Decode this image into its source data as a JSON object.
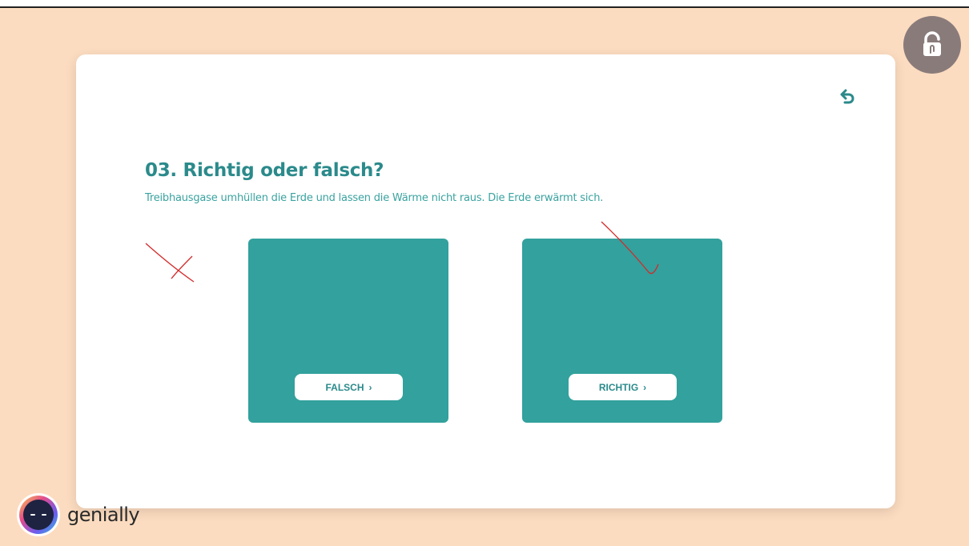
{
  "card": {
    "title": "03. Richtig oder falsch?",
    "statement": "Treibhausgase umhüllen die Erde und lassen die Wärme nicht raus. Die Erde erwärmt sich."
  },
  "options": [
    {
      "label": "FALSCH",
      "chevron": "›"
    },
    {
      "label": "RICHTIG",
      "chevron": "›"
    }
  ],
  "icons": {
    "back": "undo-arrow-icon",
    "lock": "hand-unlock-icon",
    "brand": "genially-logo-icon"
  },
  "brand": {
    "name": "genially"
  },
  "colors": {
    "background": "#fcdcc0",
    "card": "#ffffff",
    "teal": "#33a19d",
    "title": "#2b8a8b",
    "annotation": "#d42a2a",
    "lock_button": "#8a7b7b"
  }
}
